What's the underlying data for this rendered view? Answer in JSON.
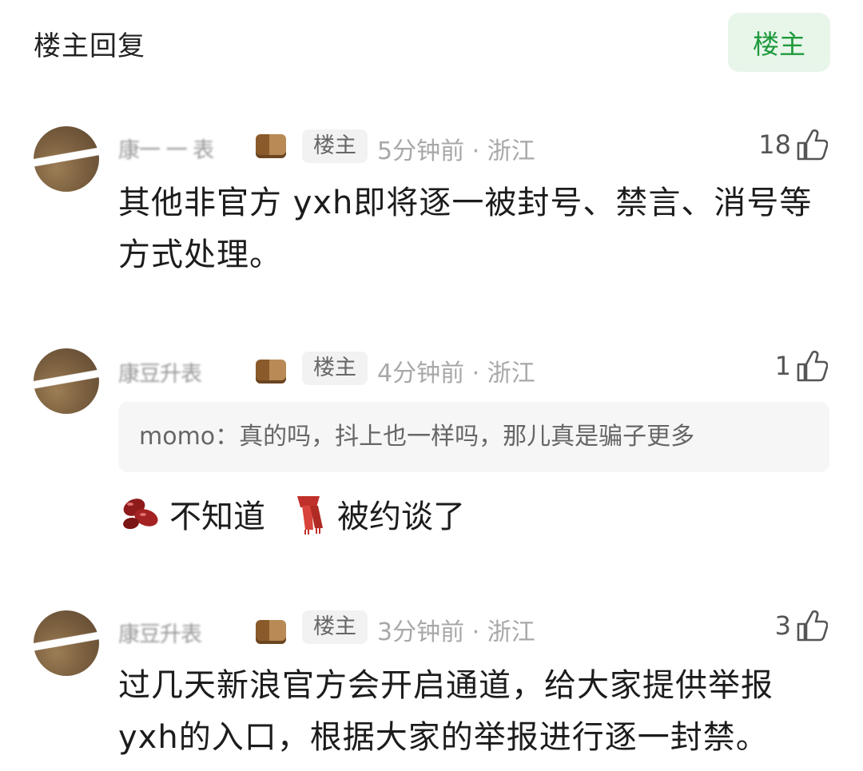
{
  "header": {
    "title": "楼主回复",
    "op_filter_label": "楼主"
  },
  "comments": [
    {
      "name": "康一 一 表",
      "op_badge": "楼主",
      "meta": "5分钟前 · 浙江",
      "likes": "18",
      "text": "其他非官方 yxh即将逐一被封号、禁言、消号等方式处理。"
    },
    {
      "name": "康豆升表",
      "op_badge": "楼主",
      "meta": "4分钟前 · 浙江",
      "likes": "1",
      "quote": "momo：真的吗，抖上也一样吗，那儿真是骗子更多",
      "reaction_1_text": "不知道",
      "reaction_2_text": "被约谈了",
      "reaction_1_emoji": "red-beans-emoji",
      "reaction_2_emoji": "scarf-emoji"
    },
    {
      "name": "康豆升表",
      "op_badge": "楼主",
      "meta": "3分钟前 · 浙江",
      "likes": "3",
      "text": "过几天新浪官方会开启通道，给大家提供举报yxh的入口，根据大家的举报进行逐一封禁。"
    }
  ],
  "colors": {
    "accent_green": "#1e9a3c",
    "badge_bg": "#e8f6ea"
  }
}
